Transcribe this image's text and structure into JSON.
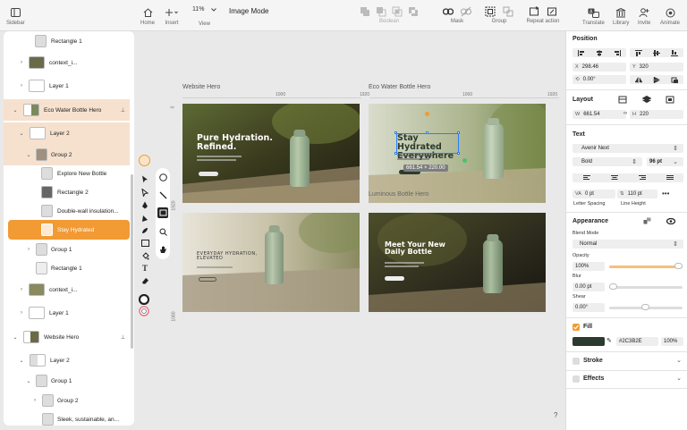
{
  "toolbar": {
    "sidebar_label": "Sidebar",
    "home_label": "Home",
    "insert_label": "Insert",
    "zoom_value": "11%",
    "view_label": "View",
    "mode_title": "Image Mode",
    "boolean_label": "Boolean",
    "mask_label": "Mask",
    "group_label": "Group",
    "repeat_label": "Repeat action",
    "translate_label": "Translate",
    "library_label": "Library",
    "invite_label": "Invite",
    "animate_label": "Animate"
  },
  "layers": [
    {
      "label": "Rectangle 1"
    },
    {
      "label": "context_i..."
    },
    {
      "label": "Layer 1"
    },
    {
      "label": "Eco Water Bottle Hero"
    },
    {
      "label": "Layer 2"
    },
    {
      "label": "Group 2"
    },
    {
      "label": "Explore New Bottle"
    },
    {
      "label": "Rectangle 2"
    },
    {
      "label": "Double-wall insulation..."
    },
    {
      "label": "Stay Hydrated"
    },
    {
      "label": "Group 1"
    },
    {
      "label": "Rectangle 1"
    },
    {
      "label": "context_i..."
    },
    {
      "label": "Layer 1"
    },
    {
      "label": "Website Hero"
    },
    {
      "label": "Layer 2"
    },
    {
      "label": "Group 1"
    },
    {
      "label": "Group 2"
    },
    {
      "label": "Sleek, sustainable, an..."
    }
  ],
  "canvas": {
    "frame1_label": "Website Hero",
    "frame2_label": "Eco Water Bottle Hero",
    "frame3_label": "Luminous Bottle Hero",
    "ruler_1000": "1000",
    "ruler_1920": "1920",
    "ruler_0": "0",
    "ruler_1080": "1080",
    "ruler_1920b": "1920",
    "ruler_1000b": "1000",
    "ruler_1920c": "1920",
    "card1_title": "Pure Hydration. Refined.",
    "card2_title": "Stay Hydrated Everywhere",
    "card3_title": "EVERYDAY HYDRATION, ELEVATED",
    "card4_title": "Meet Your New Daily Bottle",
    "size_tag": "661.54 × 220.00",
    "help": "?"
  },
  "right_panel": {
    "position_title": "Position",
    "x_label": "X",
    "x_value": "298.46",
    "y_label": "Y",
    "y_value": "320",
    "rot_value": "0.00°",
    "layout_title": "Layout",
    "w_label": "W",
    "w_value": "661.54",
    "h_label": "H",
    "h_value": "220",
    "text_title": "Text",
    "font_name": "Avenir Next",
    "font_weight": "Bold",
    "font_size": "96 pt",
    "letter_spacing_value": "0 pt",
    "line_height_value": "110 pt",
    "letter_spacing_label": "Letter Spacing",
    "line_height_label": "Line Height",
    "appearance_title": "Appearance",
    "blend_label": "Blend Mode",
    "blend_value": "Normal",
    "opacity_label": "Opacity",
    "opacity_value": "100%",
    "blur_label": "Blur",
    "blur_value": "0.00 pt",
    "shear_label": "Shear",
    "shear_value": "0.00°",
    "fill_label": "Fill",
    "fill_hex": "#2C3B2E",
    "fill_opacity": "100%",
    "stroke_label": "Stroke",
    "effects_label": "Effects"
  },
  "colors": {
    "accent": "#f29a33",
    "selection": "#2a7ff6",
    "fill_swatch": "#2C3B2E"
  }
}
